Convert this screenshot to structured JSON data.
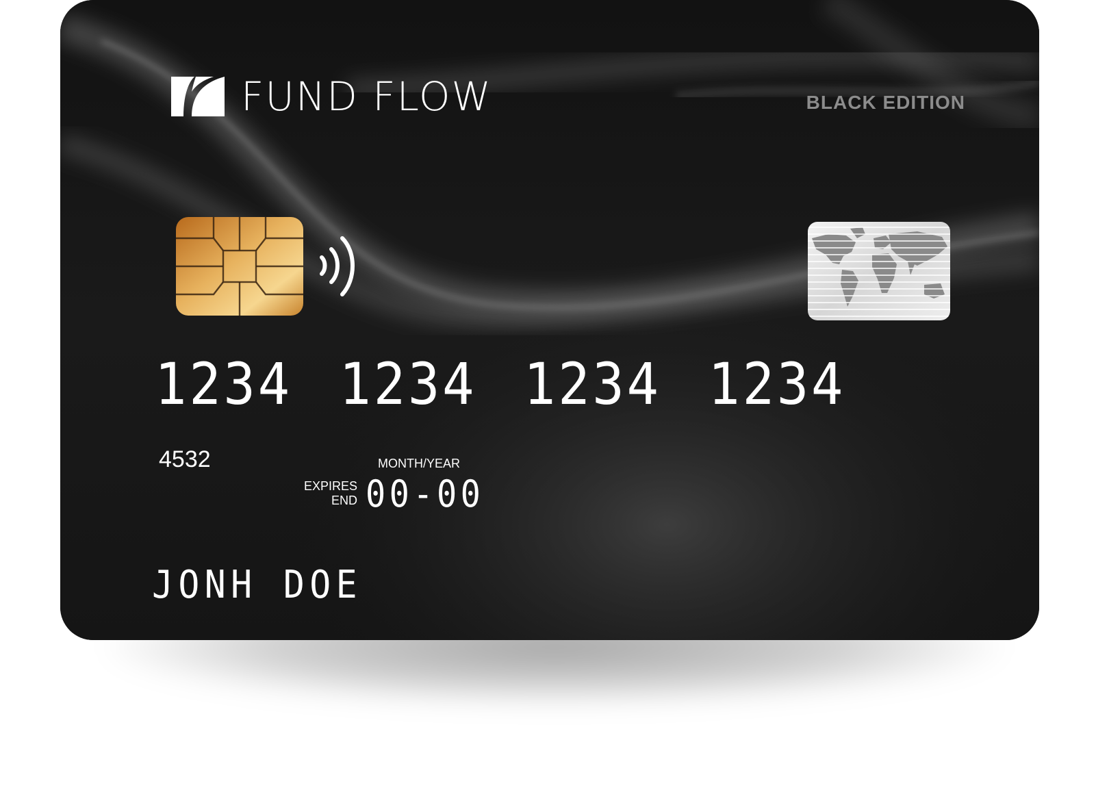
{
  "card": {
    "brand_name": "FUND FLOW",
    "edition": "BLACK EDITION",
    "number": "1234 1234 1234 1234",
    "security_code": "4532",
    "expiry_hint": "MONTH/YEAR",
    "expiry_label_line1": "EXPIRES",
    "expiry_label_line2": "END",
    "expiry_value": "00-00",
    "holder_name": "JONH DOE"
  },
  "icons": {
    "logo": "fund-flow-logo-icon",
    "chip": "emv-chip-icon",
    "contactless": "contactless-icon",
    "hologram": "world-map-hologram-icon"
  },
  "colors": {
    "card_base": "#1b1b1b",
    "text": "#ffffff",
    "edition_text": "#8c8c8c",
    "chip_gold": "#d9a24a"
  }
}
